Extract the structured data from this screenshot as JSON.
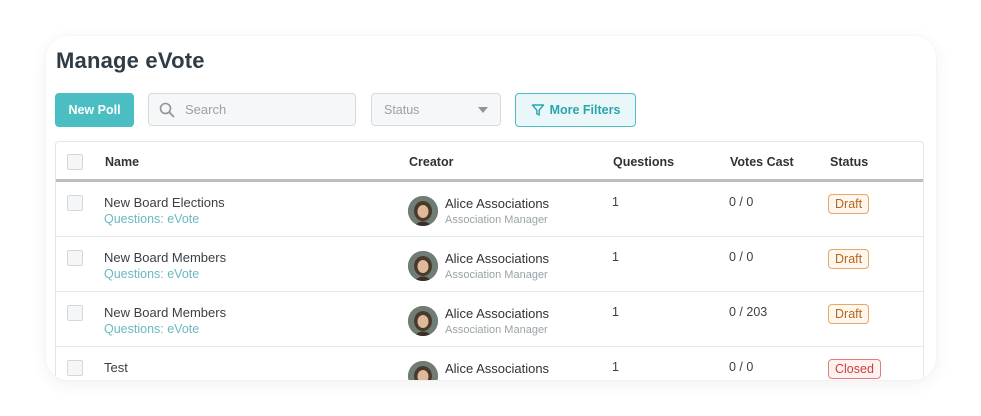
{
  "page": {
    "title": "Manage eVote"
  },
  "toolbar": {
    "new_poll_label": "New Poll",
    "search_placeholder": "Search",
    "status_placeholder": "Status",
    "more_filters_label": "More Filters"
  },
  "table": {
    "columns": [
      "Name",
      "Creator",
      "Questions",
      "Votes Cast",
      "Status"
    ],
    "rows": [
      {
        "name": "New Board Elections",
        "sub": "Questions: eVote",
        "creator": "Alice Associations",
        "role": "Association Manager",
        "questions": "1",
        "votes": "0 / 0",
        "status": "Draft",
        "status_kind": "draft"
      },
      {
        "name": "New Board Members",
        "sub": "Questions: eVote",
        "creator": "Alice Associations",
        "role": "Association Manager",
        "questions": "1",
        "votes": "0 / 0",
        "status": "Draft",
        "status_kind": "draft"
      },
      {
        "name": "New Board Members",
        "sub": "Questions: eVote",
        "creator": "Alice Associations",
        "role": "Association Manager",
        "questions": "1",
        "votes": "0 / 203",
        "status": "Draft",
        "status_kind": "draft"
      },
      {
        "name": "Test",
        "sub": "",
        "creator": "Alice Associations",
        "role": "",
        "questions": "1",
        "votes": "0 / 0",
        "status": "Closed",
        "status_kind": "closed"
      }
    ]
  },
  "colors": {
    "accent": "#4bbec4",
    "draft": "#e8a867",
    "closed": "#e27d7a"
  },
  "icons": {
    "search": "search-icon",
    "filter": "filter-icon",
    "dropdown": "chevron-down-icon"
  }
}
